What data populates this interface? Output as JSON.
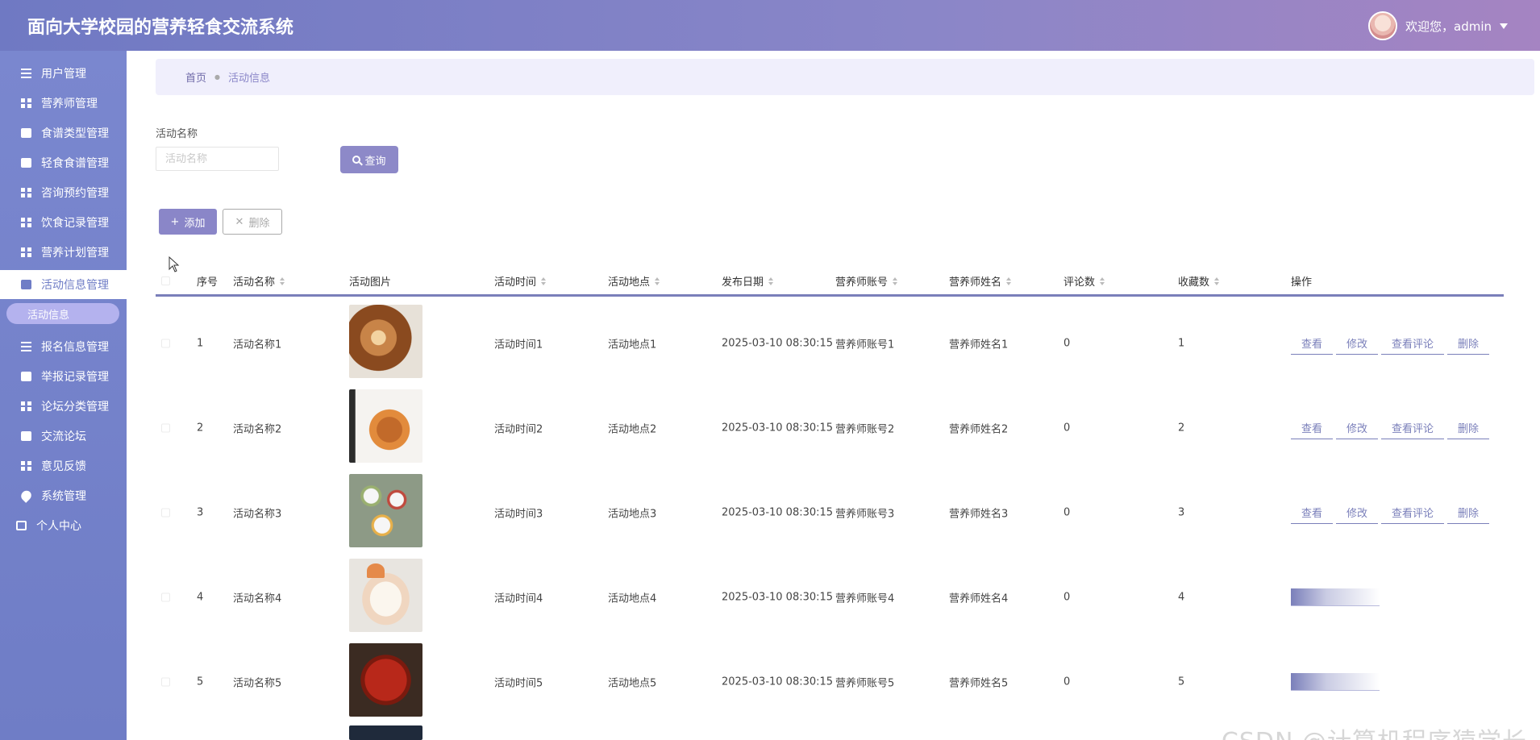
{
  "app": {
    "title": "面向大学校园的营养轻食交流系统"
  },
  "user": {
    "greeting": "欢迎您，admin"
  },
  "sidebar": {
    "items": [
      {
        "label": "用户管理",
        "icon": "list-icon"
      },
      {
        "label": "营养师管理",
        "icon": "grid-icon"
      },
      {
        "label": "食谱类型管理",
        "icon": "box-icon"
      },
      {
        "label": "轻食食谱管理",
        "icon": "monitor-icon"
      },
      {
        "label": "咨询预约管理",
        "icon": "grid-icon"
      },
      {
        "label": "饮食记录管理",
        "icon": "grid-icon"
      },
      {
        "label": "营养计划管理",
        "icon": "grid-icon"
      },
      {
        "label": "活动信息管理",
        "icon": "flag-icon"
      },
      {
        "label": "报名信息管理",
        "icon": "sliders-icon"
      },
      {
        "label": "举报记录管理",
        "icon": "book-icon"
      },
      {
        "label": "论坛分类管理",
        "icon": "grid-icon"
      },
      {
        "label": "交流论坛",
        "icon": "chart-icon"
      },
      {
        "label": "意见反馈",
        "icon": "grid-icon"
      },
      {
        "label": "系统管理",
        "icon": "pin-icon"
      },
      {
        "label": "个人中心",
        "icon": "person-icon"
      }
    ],
    "sub_active": "活动信息"
  },
  "breadcrumb": {
    "home": "首页",
    "current": "活动信息"
  },
  "search": {
    "label": "活动名称",
    "placeholder": "活动名称",
    "button": "查询"
  },
  "actions": {
    "add": "添加",
    "delete": "删除"
  },
  "table": {
    "headers": [
      "序号",
      "活动名称",
      "活动图片",
      "活动时间",
      "活动地点",
      "发布日期",
      "营养师账号",
      "营养师姓名",
      "评论数",
      "收藏数",
      "操作"
    ],
    "rows": [
      {
        "no": "1",
        "name": "活动名称1",
        "time": "活动时间1",
        "place": "活动地点1",
        "date": "2025-03-10 08:30:15",
        "account": "营养师账号1",
        "dname": "营养师姓名1",
        "comments": "0",
        "favs": "1"
      },
      {
        "no": "2",
        "name": "活动名称2",
        "time": "活动时间2",
        "place": "活动地点2",
        "date": "2025-03-10 08:30:15",
        "account": "营养师账号2",
        "dname": "营养师姓名2",
        "comments": "0",
        "favs": "2"
      },
      {
        "no": "3",
        "name": "活动名称3",
        "time": "活动时间3",
        "place": "活动地点3",
        "date": "2025-03-10 08:30:15",
        "account": "营养师账号3",
        "dname": "营养师姓名3",
        "comments": "0",
        "favs": "3"
      },
      {
        "no": "4",
        "name": "活动名称4",
        "time": "活动时间4",
        "place": "活动地点4",
        "date": "2025-03-10 08:30:15",
        "account": "营养师账号4",
        "dname": "营养师姓名4",
        "comments": "0",
        "favs": "4"
      },
      {
        "no": "5",
        "name": "活动名称5",
        "time": "活动时间5",
        "place": "活动地点5",
        "date": "2025-03-10 08:30:15",
        "account": "营养师账号5",
        "dname": "营养师姓名5",
        "comments": "0",
        "favs": "5"
      }
    ],
    "ops": {
      "view": "查看",
      "edit": "修改",
      "comments": "查看评论",
      "delete": "删除"
    }
  },
  "watermark": "CSDN @计算机程序猿学长"
}
